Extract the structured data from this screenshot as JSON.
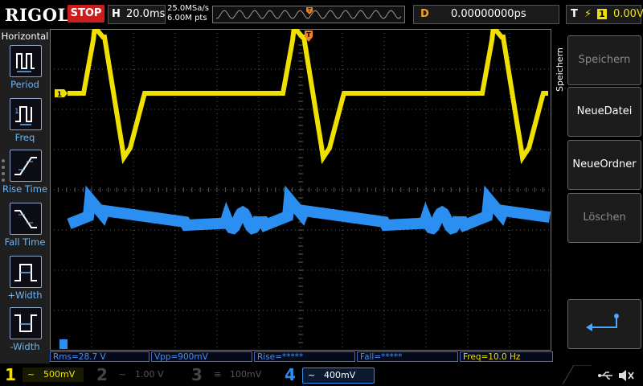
{
  "top": {
    "logo": "RIGOL",
    "run_state": "STOP",
    "horizontal_key": "H",
    "timebase": "20.0ms",
    "sample_rate": "25.0MSa/s",
    "memory_depth": "6.00M pts",
    "delay_key": "D",
    "delay_value": "0.00000000ps",
    "trigger_key": "T",
    "trigger_edge_symbol": "⚡",
    "trigger_source": "1",
    "trigger_level": "0.00V"
  },
  "left_panel": {
    "title": "Horizontal",
    "items": [
      {
        "label": "Period",
        "icon": "period-icon"
      },
      {
        "label": "Freq",
        "icon": "frequency-icon"
      },
      {
        "label": "Rise Time",
        "icon": "rise-time-icon"
      },
      {
        "label": "Fall Time",
        "icon": "fall-time-icon"
      },
      {
        "label": "+Width",
        "icon": "positive-width-icon"
      },
      {
        "label": "-Width",
        "icon": "negative-width-icon"
      }
    ]
  },
  "right_panel": {
    "title": "Speichern",
    "buttons": [
      {
        "label": "Speichern",
        "enabled": false
      },
      {
        "label": "NeueDatei",
        "enabled": true
      },
      {
        "label": "NeueOrdner",
        "enabled": true
      },
      {
        "label": "Löschen",
        "enabled": false
      }
    ],
    "enter_icon": "enter-arrow-icon"
  },
  "markers": {
    "ch1": "1",
    "trigger_pos": "T"
  },
  "measurements": [
    {
      "text": "Rms=28.7 V",
      "channel": "ch4"
    },
    {
      "text": "Vpp=900mV",
      "channel": "ch4"
    },
    {
      "text": "Rise=*****",
      "channel": "ch4"
    },
    {
      "text": "Fall=*****",
      "channel": "ch4"
    },
    {
      "text": "Freq=10.0 Hz",
      "channel": "ch1"
    }
  ],
  "channels": [
    {
      "num": "1",
      "coupling": "~",
      "scale": "500mV",
      "active": true,
      "color": "#f0e000"
    },
    {
      "num": "2",
      "coupling": "~",
      "scale": "1.00 V",
      "active": false,
      "color": "#3dd0c8"
    },
    {
      "num": "3",
      "coupling": "≡",
      "scale": "100mV",
      "active": false,
      "color": "#d050d0"
    },
    {
      "num": "4",
      "coupling": "~",
      "scale": "400mV",
      "active": true,
      "color": "#2a8ff0"
    }
  ],
  "colors": {
    "ch1": "#f0e000",
    "ch4": "#2a8ff0",
    "grid": "#5a5a5a",
    "accent": "#f08020",
    "stop": "#cc1d1d"
  },
  "status_icons": [
    "usb-icon",
    "sound-muted-icon"
  ]
}
